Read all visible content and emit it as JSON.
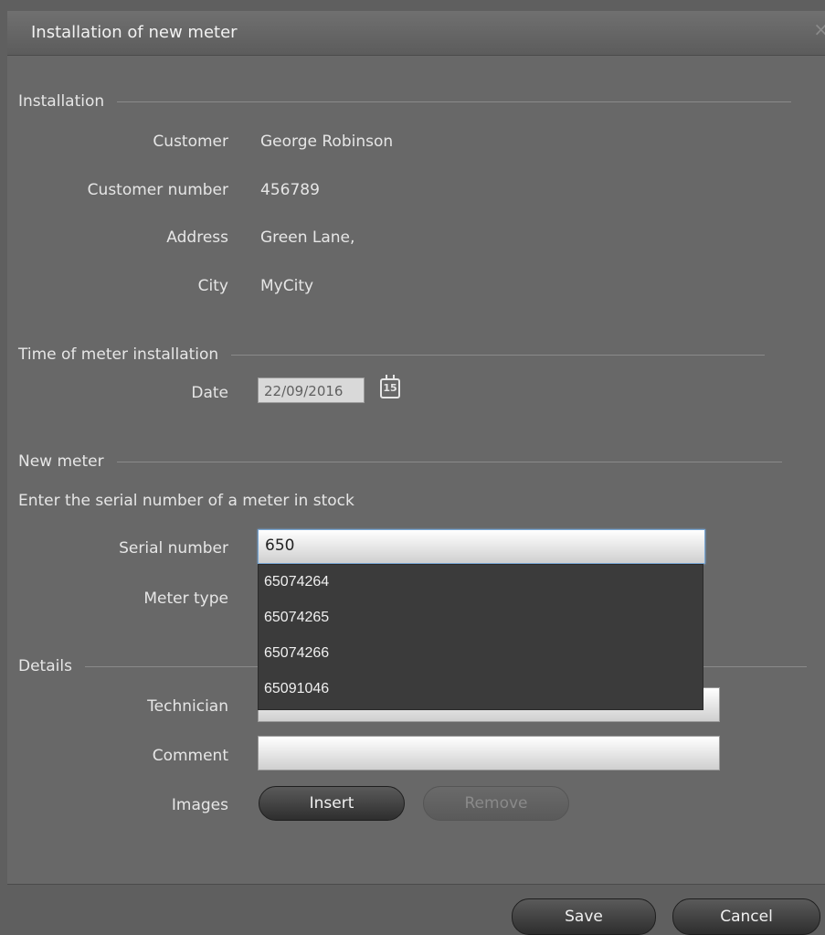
{
  "window": {
    "title": "Installation of new meter",
    "close_icon": "×"
  },
  "sections": {
    "installation": "Installation",
    "time": "Time of meter installation",
    "new_meter": "New meter",
    "details": "Details"
  },
  "installation": {
    "customer_label": "Customer",
    "customer_value": "George Robinson",
    "customer_number_label": "Customer number",
    "customer_number_value": "456789",
    "address_label": "Address",
    "address_value": "Green Lane,",
    "city_label": "City",
    "city_value": "MyCity"
  },
  "time": {
    "date_label": "Date",
    "date_value": "22/09/2016",
    "calendar_icon_text": "15"
  },
  "new_meter": {
    "instruction": "Enter the serial number of a meter in stock",
    "serial_label": "Serial number",
    "serial_value": "650",
    "meter_type_label": "Meter type",
    "suggestions": [
      "65074264",
      "65074265",
      "65074266",
      "65091046"
    ]
  },
  "details": {
    "technician_label": "Technician",
    "comment_label": "Comment",
    "images_label": "Images",
    "insert_label": "Insert",
    "remove_label": "Remove"
  },
  "footer": {
    "save_label": "Save",
    "cancel_label": "Cancel"
  }
}
